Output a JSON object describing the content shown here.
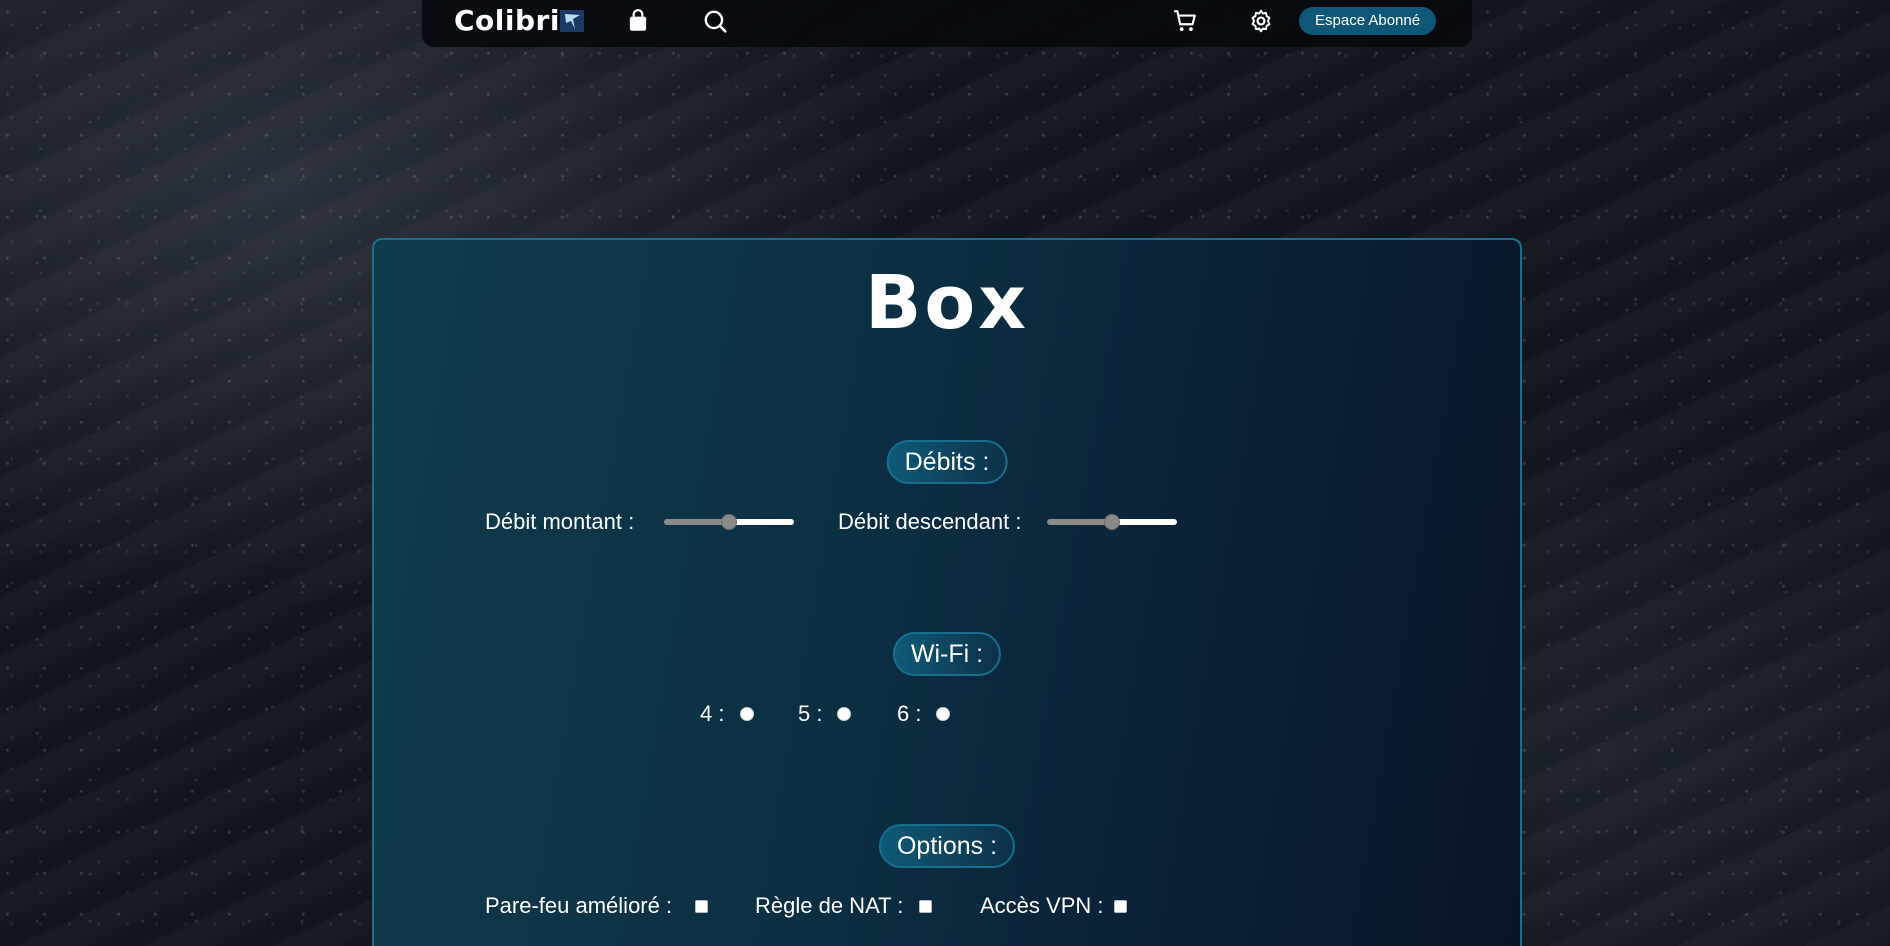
{
  "nav": {
    "logo_text": "Colibri",
    "icons": [
      "logo-mark-icon",
      "bag-icon",
      "search-icon",
      "cart-icon",
      "gear-icon"
    ],
    "subscriber_button": "Espace Abonné"
  },
  "panel": {
    "title": "Box",
    "sections": {
      "debits": {
        "heading": "Débits :",
        "upload_label": "Débit montant :",
        "upload_level": 0.5,
        "download_label": "Débit descendant :",
        "download_level": 0.5
      },
      "wifi": {
        "heading": "Wi-Fi :",
        "options": [
          "4 :",
          "5 :",
          "6 :"
        ]
      },
      "options": {
        "heading": "Options :",
        "firewall_label": "Pare-feu amélioré :",
        "nat_label": "Règle de NAT :",
        "vpn_label": "Accès VPN :"
      }
    }
  },
  "colors": {
    "accent": "#0f5777",
    "panel_border": "#1b6f8c",
    "background": "#12161d"
  }
}
